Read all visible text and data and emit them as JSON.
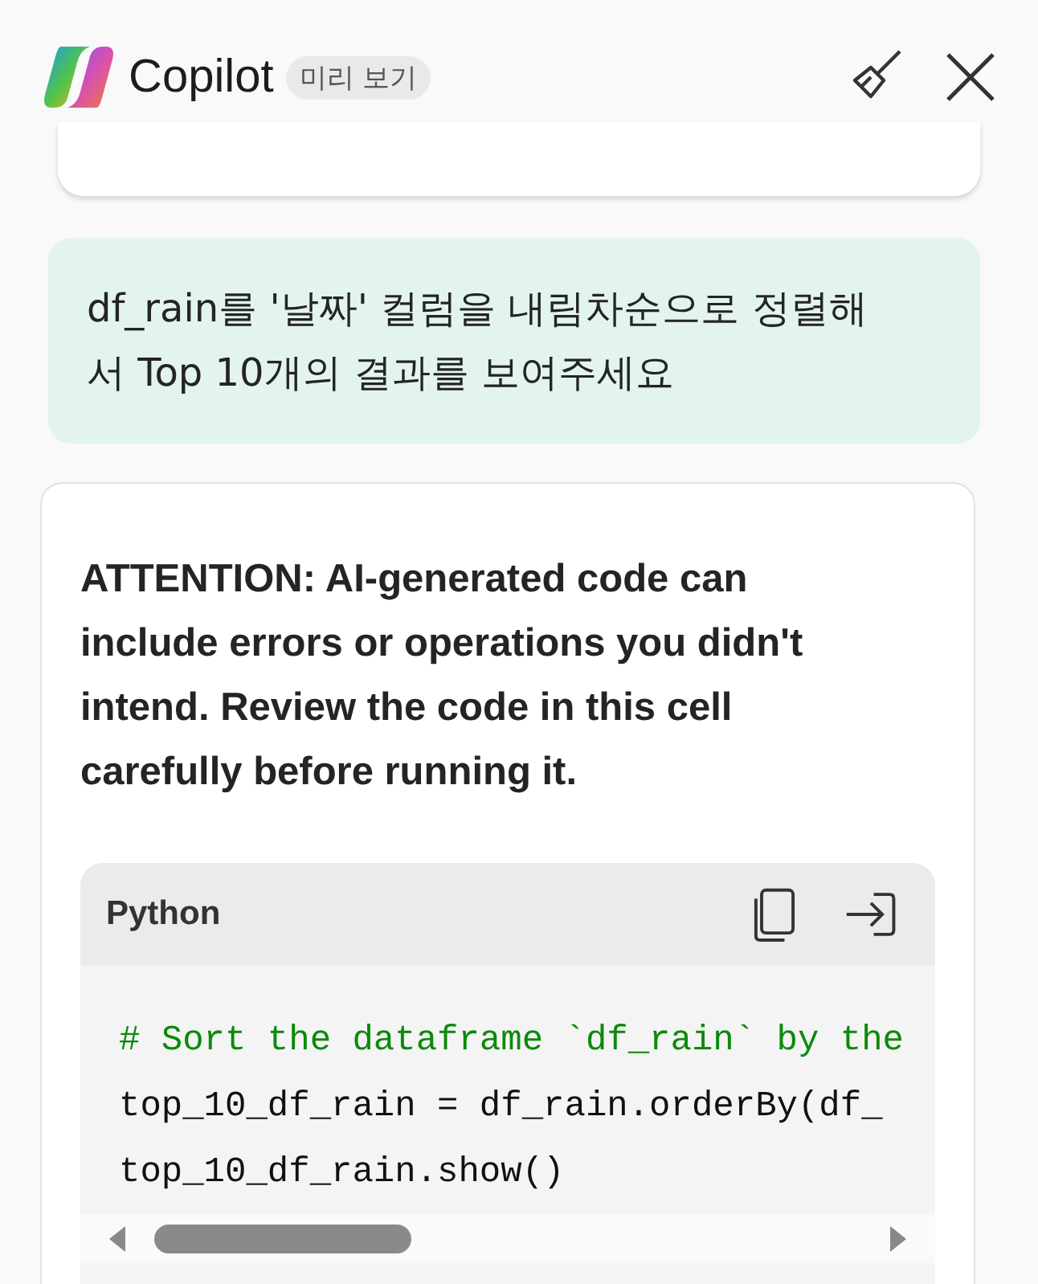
{
  "header": {
    "title": "Copilot",
    "badge": "미리 보기"
  },
  "user_message": {
    "text": "df_rain를 '날짜' 컬럼을 내림차순으로 정렬해서 Top 10개의 결과를 보여주세요"
  },
  "response": {
    "warning": "ATTENTION: AI-generated code can include errors or operations you didn't intend. Review the code in this cell carefully before running it.",
    "code_block": {
      "language": "Python",
      "lines": [
        {
          "kind": "comment",
          "text": "# Sort the dataframe `df_rain` by the"
        },
        {
          "kind": "code",
          "text": "top_10_df_rain = df_rain.orderBy(df_"
        },
        {
          "kind": "code",
          "text": "top_10_df_rain.show()"
        }
      ]
    }
  }
}
